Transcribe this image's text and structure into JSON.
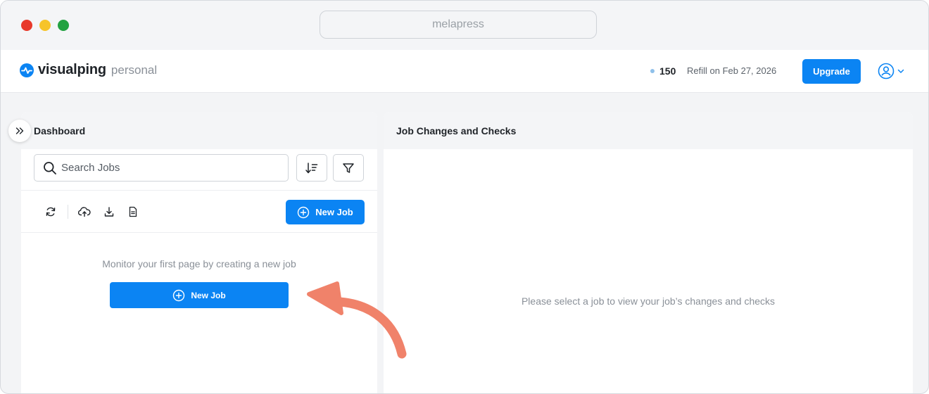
{
  "browser": {
    "url": "melapress"
  },
  "header": {
    "brand_name": "visualping",
    "brand_plan": "personal",
    "credit_count": "150",
    "refill_text": "Refill on Feb 27, 2026",
    "upgrade_label": "Upgrade"
  },
  "dashboard": {
    "title": "Dashboard",
    "search_placeholder": "Search Jobs",
    "new_job_label": "New Job",
    "empty_message": "Monitor your first page by creating a new job",
    "empty_new_job_label": "New Job"
  },
  "changes_panel": {
    "title": "Job Changes and Checks",
    "empty_message": "Please select a job to view your job’s changes and checks"
  },
  "colors": {
    "accent": "#0b84f3",
    "annotation_arrow": "#f0826a",
    "traffic_red": "#e8392b",
    "traffic_yellow": "#f6c42a",
    "traffic_green": "#23a241"
  },
  "icons": {
    "brand": "pulse-logo-icon",
    "search": "search-icon",
    "sort": "sort-icon",
    "filter": "filter-icon",
    "refresh": "refresh-icon",
    "upload": "cloud-upload-icon",
    "download": "download-icon",
    "document": "document-icon",
    "add": "plus-circle-icon",
    "collapse": "chevrons-right-icon",
    "account": "user-circle-icon"
  }
}
